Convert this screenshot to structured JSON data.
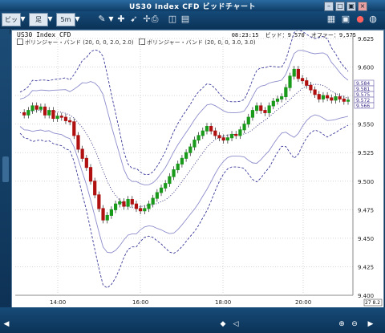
{
  "window": {
    "title": "US30 Index CFD ビッドチャート"
  },
  "toolbar": {
    "price_type": "ビッド",
    "chart_type": "足",
    "timeframe": "5m"
  },
  "chart": {
    "title": "US30 Index CFD",
    "time": "08:23:15",
    "bid_label": "ビッド：",
    "bid_value": "9,570",
    "offer_label": "オファー：",
    "offer_value": "9,575",
    "indicators": [
      "ボリンジャー・バンド (20, 0, 0, 2.0, 2.0)",
      "ボリンジャー・バンド (20, 0, 0, 3.0, 3.0)"
    ]
  },
  "chart_data": {
    "type": "candlestick",
    "y_ticks": [
      "9.625",
      "9.600",
      "9.575",
      "9.550",
      "9.525",
      "9.500",
      "9.475",
      "9.450",
      "9.425",
      "9.400"
    ],
    "x_ticks": [
      "14:00",
      "16:00",
      "18:00",
      "20:00"
    ],
    "price_markers": [
      "9.584",
      "9.581",
      "9.575",
      "9.572",
      "9.566"
    ],
    "close_marker": "27 8.2",
    "ylim": [
      9.4,
      9.625
    ],
    "colors": {
      "up": "#1a9a1a",
      "down": "#b01010",
      "band_inner": "#8d8dcc",
      "band_outer": "#3a3a9a",
      "mid": "#2a2a7a"
    }
  }
}
